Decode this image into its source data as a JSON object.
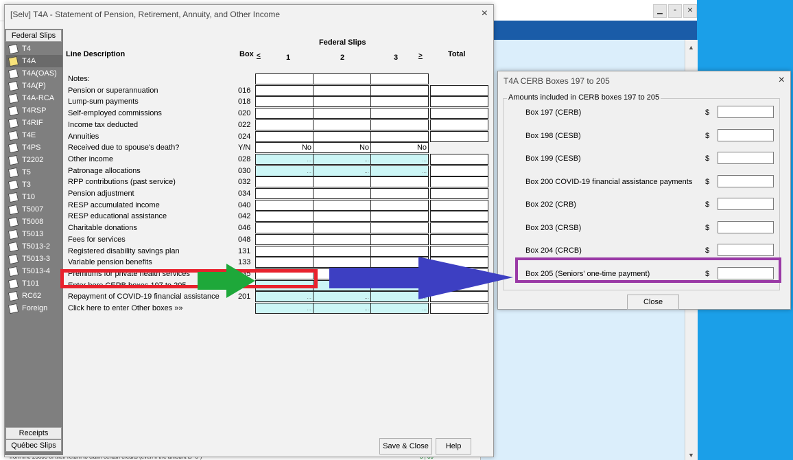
{
  "main_dialog": {
    "title": "[Selv] T4A  - Statement of Pension, Retirement, Annuity, and Other Income",
    "close_icon": "×"
  },
  "sidebar": {
    "top_tab": "Federal Slips",
    "slips": [
      "T4",
      "T4A",
      "T4A(OAS)",
      "T4A(P)",
      "T4A-RCA",
      "T4RSP",
      "T4RIF",
      "T4E",
      "T4PS",
      "T2202",
      "T5",
      "T3",
      "T10",
      "T5007",
      "T5008",
      "T5013",
      "T5013-2",
      "T5013-3",
      "T5013-4",
      "T101",
      "RC62",
      "Foreign"
    ],
    "selected": "T4A",
    "bottom_tabs": [
      "Receipts",
      "Québec Slips"
    ]
  },
  "form": {
    "group_header": "Federal Slips",
    "col_line_description": "Line Description",
    "col_box": "Box",
    "nav_prev": "<",
    "nav_next": ">",
    "col1": "1",
    "col2": "2",
    "col3": "3",
    "col_total": "Total",
    "rows": [
      {
        "desc": "Notes:",
        "box": ""
      },
      {
        "desc": "Pension or superannuation",
        "box": "016"
      },
      {
        "desc": "Lump-sum payments",
        "box": "018"
      },
      {
        "desc": "Self-employed commissions",
        "box": "020"
      },
      {
        "desc": "Income tax deducted",
        "box": "022"
      },
      {
        "desc": "Annuities",
        "box": "024"
      },
      {
        "desc": "Received due to spouse's death?",
        "box": "Y/N",
        "c1": "No",
        "c2": "No",
        "c3": "No"
      },
      {
        "desc": "Other income",
        "box": "028",
        "c1": "...",
        "c2": "...",
        "c3": "..."
      },
      {
        "desc": "Patronage allocations",
        "box": "030",
        "c1": "...",
        "c2": "...",
        "c3": "..."
      },
      {
        "desc": "RPP contributions (past service)",
        "box": "032"
      },
      {
        "desc": "Pension adjustment",
        "box": "034"
      },
      {
        "desc": "RESP accumulated income",
        "box": "040"
      },
      {
        "desc": "RESP educational assistance",
        "box": "042"
      },
      {
        "desc": "Charitable donations",
        "box": "046"
      },
      {
        "desc": "Fees for services",
        "box": "048"
      },
      {
        "desc": "Registered disability savings plan",
        "box": "131"
      },
      {
        "desc": "Variable pension benefits",
        "box": "133"
      },
      {
        "desc": "Premiums for private health services",
        "box": "135"
      },
      {
        "desc": "Enter here CERB boxes 197 to 205",
        "box": ""
      },
      {
        "desc": "Repayment of COVID-19 financial assistance",
        "box": "201",
        "c1": "...",
        "c2": "...",
        "c3": "..."
      },
      {
        "desc": "Click here to enter Other boxes »»",
        "box": "",
        "c1": "...",
        "c2": "...",
        "c3": "..."
      }
    ],
    "save_close": "Save & Close",
    "help": "Help"
  },
  "cerb_dialog": {
    "title": "T4A CERB Boxes 197 to 205",
    "close_icon": "×",
    "group_label": "Amounts included in CERB boxes 197 to 205",
    "currency": "$",
    "boxes": [
      "Box 197 (CERB)",
      "Box 198 (CESB)",
      "Box 199 (CESB)",
      "Box 200 COVID-19 financial assistance payments",
      "Box 202 (CRB)",
      "Box 203 (CRSB)",
      "Box 204 (CRCB)",
      "Box 205 (Seniors' one-time payment)"
    ],
    "close_button": "Close"
  },
  "background": {
    "footer_text": "from line 23600 of their return to claim certain credits (even if the amount is \"0\")",
    "footer_nums": "0 |  00"
  },
  "annotations": {
    "red_color": "#e8222d",
    "green_color": "#1ea83a",
    "blue_color": "#3d3fc2",
    "purple_color": "#9a3aa6"
  }
}
